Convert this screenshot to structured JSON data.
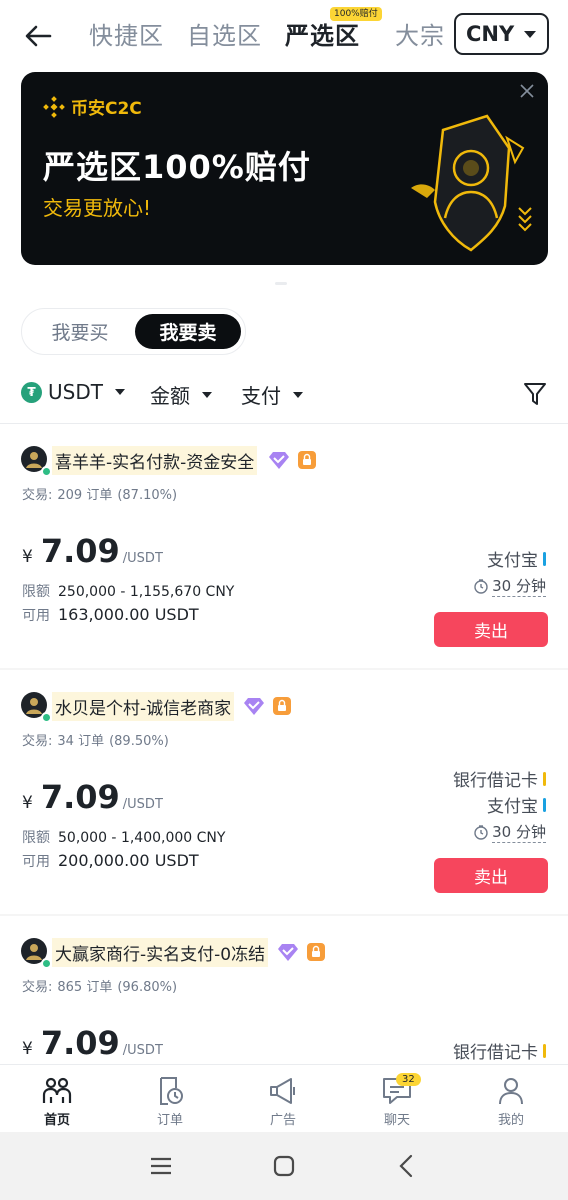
{
  "nav": {
    "tabs": [
      {
        "label": "快捷区",
        "active": false
      },
      {
        "label": "自选区",
        "active": false
      },
      {
        "label": "严选区",
        "active": true,
        "badge": "100%赔付"
      },
      {
        "label": "大宗",
        "active": false
      }
    ],
    "currency": "CNY"
  },
  "banner": {
    "brand": "币安C2C",
    "title": "严选区100%赔付",
    "subtitle": "交易更放心!"
  },
  "toggle": {
    "buy": "我要买",
    "sell": "我要卖",
    "selected": "sell"
  },
  "filters": {
    "asset": "USDT",
    "amount": "金额",
    "payment": "支付"
  },
  "ads": [
    {
      "merchant": "喜羊羊-实名付款-资金安全",
      "trades_label": "交易:",
      "orders": "209 订单",
      "completion": "(87.10%)",
      "currency_symbol": "¥",
      "price": "7.09",
      "unit": "/USDT",
      "limit_label": "限额",
      "limit": "250,000 - 1,155,670 CNY",
      "available_label": "可用",
      "available": "163,000.00 USDT",
      "payments": [
        {
          "name": "支付宝",
          "color": "#1aa1e1"
        }
      ],
      "time": "30 分钟",
      "action": "卖出"
    },
    {
      "merchant": "水贝是个村-诚信老商家",
      "trades_label": "交易:",
      "orders": "34 订单",
      "completion": "(89.50%)",
      "currency_symbol": "¥",
      "price": "7.09",
      "unit": "/USDT",
      "limit_label": "限额",
      "limit": "50,000 - 1,400,000 CNY",
      "available_label": "可用",
      "available": "200,000.00 USDT",
      "payments": [
        {
          "name": "银行借记卡",
          "color": "#f0b90b"
        },
        {
          "name": "支付宝",
          "color": "#1aa1e1"
        }
      ],
      "time": "30 分钟",
      "action": "卖出"
    },
    {
      "merchant": "大赢家商行-实名支付-0冻结",
      "trades_label": "交易:",
      "orders": "865 订单",
      "completion": "(96.80%)",
      "currency_symbol": "¥",
      "price": "7.09",
      "unit": "/USDT",
      "payments": [
        {
          "name": "银行借记卡",
          "color": "#f0b90b"
        }
      ]
    }
  ],
  "tabbar": {
    "items": [
      {
        "label": "首页",
        "icon": "home-icon",
        "active": true
      },
      {
        "label": "订单",
        "icon": "orders-icon",
        "active": false
      },
      {
        "label": "广告",
        "icon": "megaphone-icon",
        "active": false
      },
      {
        "label": "聊天",
        "icon": "chat-icon",
        "active": false
      },
      {
        "label": "我的",
        "icon": "profile-icon",
        "active": false
      }
    ],
    "chat_badge": "32"
  }
}
